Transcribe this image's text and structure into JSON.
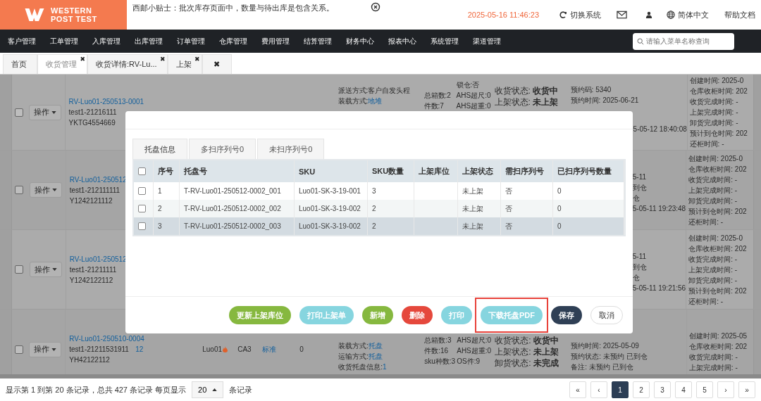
{
  "logo": {
    "line1": "WESTERN",
    "line2": "POST **TEST**"
  },
  "tip": "西邮小贴士：批次库存页面中，数量与待出库是包含关系。",
  "datetime": "2025-05-16 11:46:23",
  "switch_system": "切换系统",
  "language": "简体中文",
  "help": "帮助文档",
  "nav": [
    "客户管理",
    "工单管理",
    "入库管理",
    "出库管理",
    "订单管理",
    "仓库管理",
    "费用管理",
    "结算管理",
    "财务中心",
    "报表中心",
    "系统管理",
    "渠道管理"
  ],
  "menu_search": {
    "placeholder": "请输入菜单名称查询"
  },
  "page_tabs": [
    {
      "label": "首页",
      "selected": false,
      "closable": false
    },
    {
      "label": "收货管理",
      "selected": true,
      "closable": true
    },
    {
      "label": "收货详情:RV-Lu...",
      "selected": false,
      "closable": true
    },
    {
      "label": "上架",
      "selected": false,
      "closable": true
    }
  ],
  "close_all": "✖",
  "tab_close": "✖",
  "rows": [
    {
      "checked": false,
      "action": "操作",
      "order": {
        "id": "RV-Luo01-250513-0001",
        "customer": "test1-21216111",
        "ref": "YKTG4554669"
      },
      "mid": {
        "delivery": [
          {
            "label": "派送方式:客户自发头程"
          },
          {
            "label": "装载方式:",
            "value": "地堆"
          }
        ],
        "boxes": [
          "总箱数:2",
          "件数:7"
        ],
        "ahs": [
          "锁仓:否",
          "AHS超尺:0",
          "AHS超重:0"
        ],
        "status": [
          {
            "label": "收货状态:",
            "value": "收货中"
          },
          {
            "label": "上架状态:",
            "value": "未上架"
          }
        ]
      },
      "booking": {
        "top": [
          "预约码: 5340",
          "预约时间: 2025-06-21"
        ],
        "bottom": [
          "5-05-12 18:40:08"
        ]
      },
      "times": [
        "创建时间: 2025-0",
        "仓库收柜时间: 202",
        "收货完成时间: -",
        "上架完成时间: -",
        "卸货完成时间: -",
        "预计到仓时间: 202",
        "还柜时间: -"
      ]
    },
    {
      "checked": false,
      "action": "操作",
      "order": {
        "id": "RV-Luo01-250512",
        "customer": "test1-212111111",
        "ref": "Y1242121112"
      },
      "booking": {
        "bottom": [
          "5-11",
          "到仓",
          "仓",
          "5-05-11 19:23:48"
        ]
      },
      "times": [
        "创建时间: 2025-0",
        "仓库收柜时间: 202",
        "收货完成时间: -",
        "上架完成时间: -",
        "卸货完成时间: -",
        "预计到仓时间: 202",
        "还柜时间: -"
      ]
    },
    {
      "checked": false,
      "action": "操作",
      "order": {
        "id": "RV-Luo01-250512",
        "customer": "test1-21211111",
        "ref": "Y1242122112"
      },
      "booking": {
        "bottom": [
          "5-11",
          "到仓",
          "仓",
          "5-05-11 19:21:56"
        ]
      },
      "times": [
        "创建时间: 2025-0",
        "仓库收柜时间: 202",
        "收货完成时间: -",
        "上架完成时间: -",
        "卸货完成时间: -",
        "预计到仓时间: 202",
        "还柜时间: -"
      ]
    },
    {
      "checked": false,
      "action": "操作",
      "order": {
        "id": "RV-Luo01-250510-0004",
        "customer": "test1-21211531911",
        "ref": "YH42122112"
      },
      "cells": {
        "count": "12",
        "warehouse": "Luo01",
        "code": "CA3",
        "type": "标准",
        "qty": "0"
      },
      "mid": {
        "delivery": [
          {
            "label": "装载方式:",
            "value": "托盘"
          },
          {
            "label": "运输方式:",
            "value": "托盘"
          },
          {
            "label": "收货托盘信息:",
            "value": "1"
          }
        ],
        "boxes": [
          "总箱数:3",
          "件数:16",
          "sku种数:3"
        ],
        "ahs": [
          "AHS超尺:0",
          "AHS超重:0",
          "OS件:9"
        ],
        "status": [
          {
            "label": "收货状态:",
            "value": "收货中"
          },
          {
            "label": "上架状态:",
            "value": "未上架"
          },
          {
            "label": "卸货状态:",
            "value": "未完成"
          }
        ]
      },
      "booking": {
        "top": [
          "预约时间: 2025-05-09",
          "预约状态: 未预约 已到仓",
          "备注: 未预约 已到仓"
        ]
      },
      "times": [
        "创建时间: 2025-05",
        "仓库收柜时间: 202",
        "收货完成时间: -",
        "上架完成时间: -"
      ]
    }
  ],
  "modal": {
    "tabs": [
      {
        "label": "托盘信息",
        "selected": true
      },
      {
        "label": "多扫序列号0",
        "selected": false
      },
      {
        "label": "未扫序列号0",
        "selected": false
      }
    ],
    "select_all_checked": false,
    "columns": [
      "序号",
      "托盘号",
      "SKU",
      "SKU数量",
      "上架库位",
      "上架状态",
      "需扫序列号",
      "已扫序列号数量"
    ],
    "rows": [
      {
        "checked": false,
        "hovered": false,
        "cells": [
          "1",
          "T-RV-Luo01-250512-0002_001",
          "Luo01-SK-3-19-001",
          "3",
          "",
          "未上架",
          "否",
          "0"
        ]
      },
      {
        "checked": false,
        "hovered": false,
        "cells": [
          "2",
          "T-RV-Luo01-250512-0002_002",
          "Luo01-SK-3-19-002",
          "2",
          "",
          "未上架",
          "否",
          "0"
        ]
      },
      {
        "checked": false,
        "hovered": true,
        "cells": [
          "3",
          "T-RV-Luo01-250512-0002_003",
          "Luo01-SK-3-19-002",
          "2",
          "",
          "未上架",
          "否",
          "0"
        ]
      }
    ],
    "buttons": [
      {
        "label": "更新上架库位",
        "kind": "green",
        "highlighted": false
      },
      {
        "label": "打印上架单",
        "kind": "cyan",
        "highlighted": false
      },
      {
        "label": "新增",
        "kind": "green",
        "highlighted": false
      },
      {
        "label": "删除",
        "kind": "red",
        "highlighted": false
      },
      {
        "label": "打印",
        "kind": "cyan",
        "highlighted": false
      },
      {
        "label": "下载托盘PDF",
        "kind": "cyan",
        "highlighted": true
      },
      {
        "label": "保存",
        "kind": "navy",
        "highlighted": false
      },
      {
        "label": "取消",
        "kind": "plain",
        "highlighted": false
      }
    ]
  },
  "footer": {
    "before": "显示第 1 到第 20 条记录，总共 427 条记录 每页显示",
    "page_size": "20",
    "after": "条记录"
  },
  "pagination": [
    {
      "label": "«",
      "selected": false
    },
    {
      "label": "‹",
      "selected": false
    },
    {
      "label": "1",
      "selected": true
    },
    {
      "label": "2",
      "selected": false
    },
    {
      "label": "3",
      "selected": false
    },
    {
      "label": "4",
      "selected": false
    },
    {
      "label": "5",
      "selected": false
    },
    {
      "label": "›",
      "selected": false
    },
    {
      "label": "»",
      "selected": false
    }
  ]
}
